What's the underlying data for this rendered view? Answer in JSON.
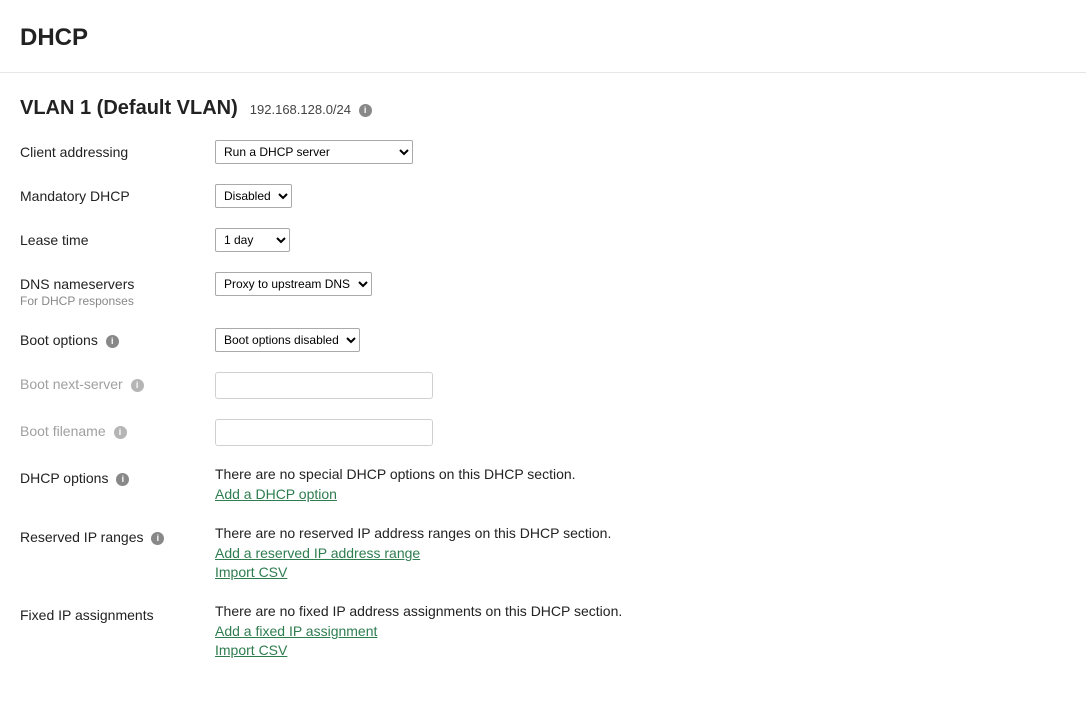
{
  "page_title": "DHCP",
  "vlan": {
    "title": "VLAN 1 (Default VLAN)",
    "subnet": "192.168.128.0/24"
  },
  "fields": {
    "client_addressing": {
      "label": "Client addressing",
      "value": "Run a DHCP server"
    },
    "mandatory_dhcp": {
      "label": "Mandatory DHCP",
      "value": "Disabled"
    },
    "lease_time": {
      "label": "Lease time",
      "value": "1 day"
    },
    "dns_nameservers": {
      "label": "DNS nameservers",
      "subtext": "For DHCP responses",
      "value": "Proxy to upstream DNS"
    },
    "boot_options": {
      "label": "Boot options",
      "value": "Boot options disabled"
    },
    "boot_next_server": {
      "label": "Boot next-server",
      "value": ""
    },
    "boot_filename": {
      "label": "Boot filename",
      "value": ""
    },
    "dhcp_options": {
      "label": "DHCP options",
      "empty_text": "There are no special DHCP options on this DHCP section.",
      "add_link": "Add a DHCP option"
    },
    "reserved_ip": {
      "label": "Reserved IP ranges",
      "empty_text": "There are no reserved IP address ranges on this DHCP section.",
      "add_link": "Add a reserved IP address range",
      "import_link": "Import CSV"
    },
    "fixed_ip": {
      "label": "Fixed IP assignments",
      "empty_text": "There are no fixed IP address assignments on this DHCP section.",
      "add_link": "Add a fixed IP assignment",
      "import_link": "Import CSV"
    }
  }
}
